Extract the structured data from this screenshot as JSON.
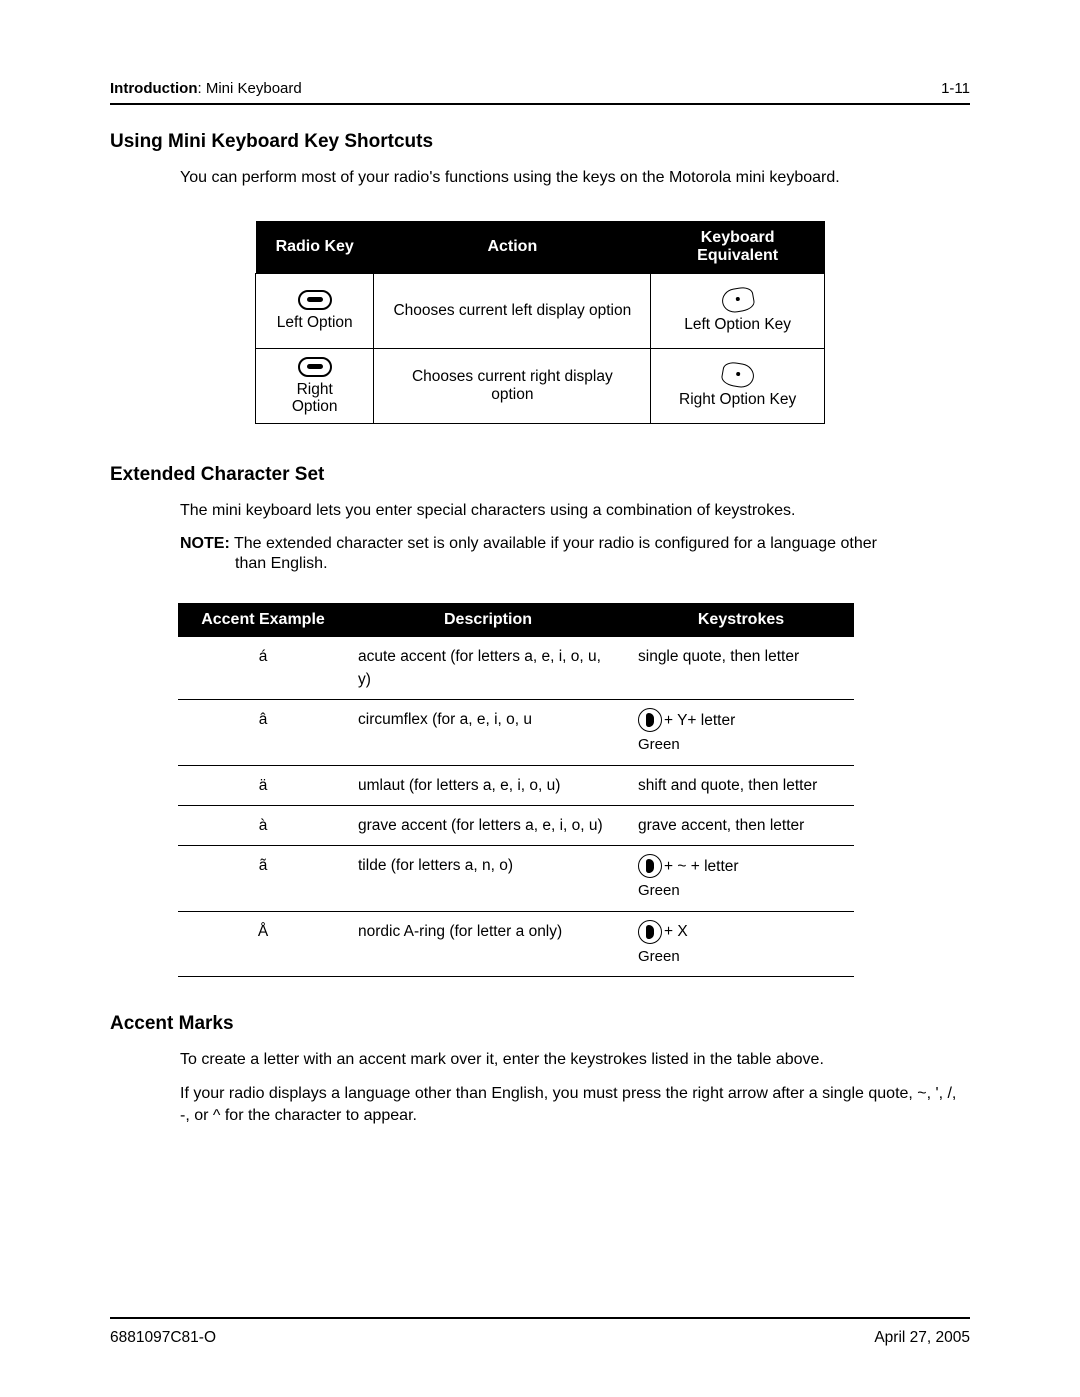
{
  "header": {
    "section": "Introduction",
    "subsection": "Mini Keyboard",
    "page_number": "1-11"
  },
  "sections": {
    "shortcuts": {
      "heading": "Using Mini Keyboard Key Shortcuts",
      "intro": "You can perform most of your radio's functions using the keys on the Motorola mini keyboard."
    },
    "extended": {
      "heading": "Extended Character Set",
      "intro": "The mini keyboard lets you enter special characters using a combination of keystrokes.",
      "note_label": "NOTE:",
      "note_line1": "The extended character set is only available if your radio is configured for a language other",
      "note_line2": "than English."
    },
    "accent": {
      "heading": "Accent Marks",
      "p1": "To create a letter with an accent mark over it, enter the keystrokes listed in the table above.",
      "p2": "If your radio displays a language other than English, you must press the right arrow after a single quote, ~, ', /, -, or ^ for the character to appear."
    }
  },
  "table1": {
    "col1": "Radio Key",
    "col2": "Action",
    "col3": "Keyboard Equivalent",
    "rows": [
      {
        "radio_label": "Left Option",
        "action": "Chooses current left display option",
        "kbd_label": "Left Option Key"
      },
      {
        "radio_label": "Right Option",
        "action": "Chooses current right display option",
        "kbd_label": "Right Option Key"
      }
    ]
  },
  "table2": {
    "col1": "Accent Example",
    "col2": "Description",
    "col3": "Keystrokes",
    "green_label": "Green",
    "rows": [
      {
        "ex": "á",
        "desc": "acute accent (for letters a, e, i, o, u, y)",
        "ks_type": "text",
        "ks": "single quote, then letter"
      },
      {
        "ex": "â",
        "desc": "circumflex (for a, e, i, o, u",
        "ks_type": "green",
        "ks": "+ Y+ letter"
      },
      {
        "ex": "ä",
        "desc": "umlaut (for letters a, e, i, o, u)",
        "ks_type": "text",
        "ks": "shift and quote, then letter"
      },
      {
        "ex": "à",
        "desc": "grave accent (for letters a, e, i, o, u)",
        "ks_type": "text",
        "ks": "grave accent, then letter"
      },
      {
        "ex": "ã",
        "desc": "tilde (for letters a, n, o)",
        "ks_type": "green",
        "ks": "+ ~ + letter"
      },
      {
        "ex": "Å",
        "desc": "nordic A-ring (for letter a only)",
        "ks_type": "green",
        "ks": "+ X"
      }
    ]
  },
  "footer": {
    "doc_id": "6881097C81-O",
    "date": "April 27, 2005"
  }
}
